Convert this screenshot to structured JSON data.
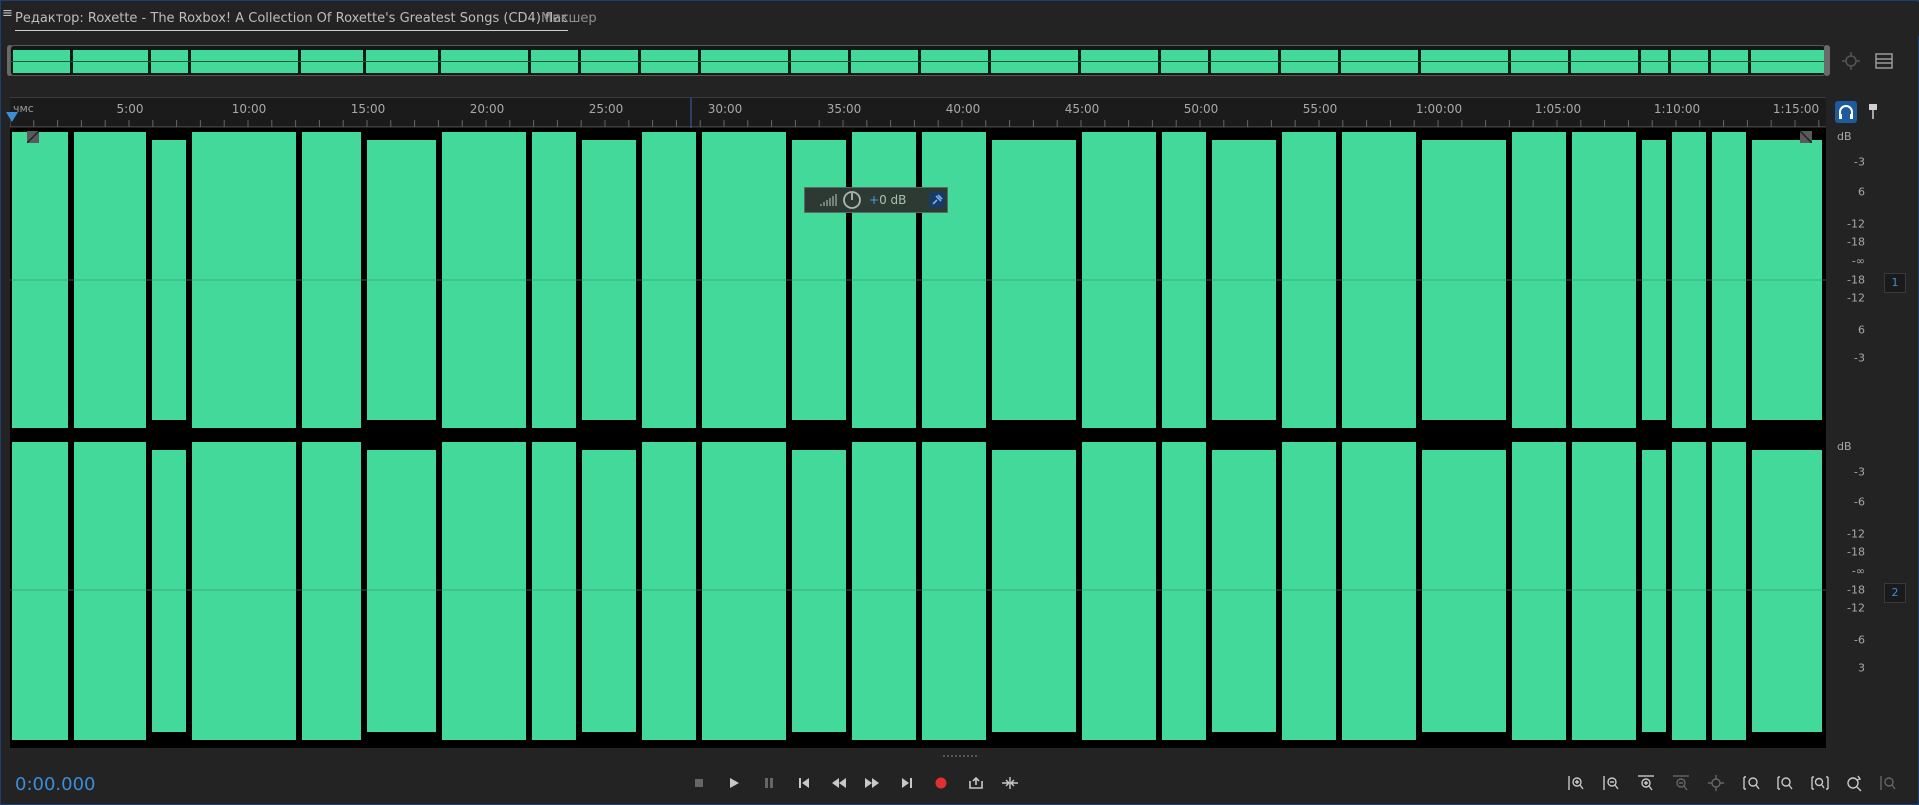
{
  "tabs": {
    "editor_label": "Редактор: Roxette - The Roxbox! A Collection Of Roxette's Greatest Songs (CD4).flac",
    "editor_menu_glyph": "≡",
    "mixer_label": "Микшер"
  },
  "ruler": {
    "unit": "чмс",
    "ticks": [
      "5:00",
      "10:00",
      "15:00",
      "20:00",
      "25:00",
      "30:00",
      "35:00",
      "40:00",
      "45:00",
      "50:00",
      "55:00",
      "1:00:00",
      "1:05:00",
      "1:10:00",
      "1:15:00"
    ]
  },
  "hud": {
    "plus_sign": "+",
    "value": "0 dB"
  },
  "scale": {
    "unit": "dB",
    "channel1_labels": [
      "-3",
      "6",
      "-12",
      "-18",
      "-∞",
      "-18",
      "-12",
      "6",
      "-3"
    ],
    "channel2_labels": [
      "-3",
      "-6",
      "-12",
      "-18",
      "-∞",
      "-18",
      "-12",
      "-6",
      "3"
    ],
    "channel1_badge": "1",
    "channel2_badge": "2"
  },
  "transport": {
    "time": "0:00.000"
  },
  "colors": {
    "waveform": "#43d99a",
    "accent": "#3b8ed8",
    "record": "#e03030"
  },
  "icons": {
    "transport": [
      "stop-icon",
      "play-icon",
      "pause-icon",
      "skip-to-start-icon",
      "rewind-icon",
      "fast-forward-icon",
      "skip-to-end-icon",
      "record-icon",
      "loop-playback-icon",
      "skip-selection-icon"
    ],
    "zoom": [
      "zoom-in-amplitude-icon",
      "zoom-out-amplitude-icon",
      "zoom-in-time-icon",
      "zoom-out-time-icon",
      "zoom-out-full-icon",
      "zoom-in-at-start-icon",
      "zoom-in-at-end-icon",
      "zoom-to-selection-icon",
      "zoom-reset-icon",
      "zoom-extra-icon"
    ]
  }
}
